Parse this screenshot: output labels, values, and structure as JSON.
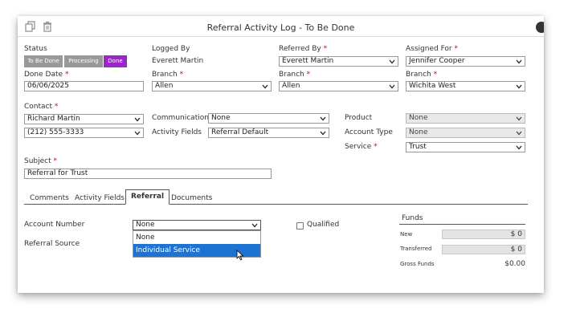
{
  "window": {
    "title": "Referral Activity Log - To Be Done"
  },
  "toolbar": {
    "copy_icon": "copy-icon",
    "delete_icon": "trash-icon"
  },
  "status": {
    "label": "Status",
    "buttons": [
      {
        "label": "To Be Done",
        "color": "#999999"
      },
      {
        "label": "Processing",
        "color": "#999999"
      },
      {
        "label": "Done",
        "color": "#9b27c9"
      }
    ]
  },
  "logged_by": {
    "label": "Logged By",
    "value": "Everett Martin"
  },
  "referred_by": {
    "label": "Referred By",
    "value": "Everett Martin"
  },
  "assigned_for": {
    "label": "Assigned For",
    "value": "Jennifer Cooper"
  },
  "done_date": {
    "label": "Done Date",
    "value": "06/06/2025"
  },
  "branch1": {
    "label": "Branch",
    "value": "Allen"
  },
  "branch2": {
    "label": "Branch",
    "value": "Allen"
  },
  "branch3": {
    "label": "Branch",
    "value": "Wichita West"
  },
  "contact": {
    "label": "Contact",
    "name": "Richard Martin",
    "phone": "(212) 555-3333"
  },
  "communication": {
    "label": "Communication",
    "value": "None"
  },
  "activity_fields": {
    "label": "Activity Fields",
    "value": "Referral Default"
  },
  "product": {
    "label": "Product",
    "value": "None"
  },
  "account_type": {
    "label": "Account Type",
    "value": "None"
  },
  "service": {
    "label": "Service",
    "value": "Trust"
  },
  "subject": {
    "label": "Subject",
    "value": "Referral for Trust"
  },
  "required_mark": "*",
  "tabs": [
    {
      "label": "Comments"
    },
    {
      "label": "Activity Fields"
    },
    {
      "label": "Referral"
    },
    {
      "label": "Documents"
    }
  ],
  "referral": {
    "account_number_label": "Account Number",
    "account_number_value": "None",
    "dropdown_options": [
      "None",
      "Individual Service"
    ],
    "highlighted_option": "Individual Service",
    "referral_source_label": "Referral Source",
    "qualified_label": "Qualified"
  },
  "funds": {
    "title": "Funds",
    "new_label": "New",
    "new_value": "$ 0",
    "transferred_label": "Transferred",
    "transferred_value": "$ 0",
    "gross_label": "Gross Funds",
    "gross_value": "$0.00"
  }
}
